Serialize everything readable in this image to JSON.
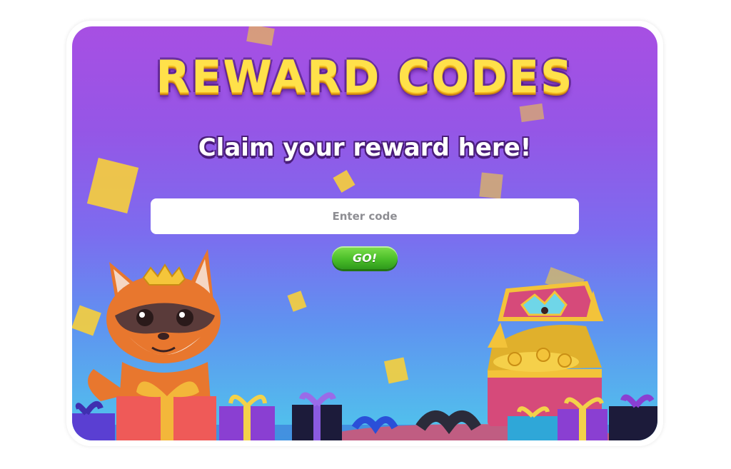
{
  "title": "REWARD CODES",
  "subtitle": "Claim your reward here!",
  "code_input": {
    "placeholder": "Enter code",
    "value": ""
  },
  "go_button": {
    "label": "GO!"
  },
  "illustration": {
    "mascot": "fox-mascot",
    "chest": "treasure-chest-icon",
    "gifts": "gift-box-icon"
  },
  "colors": {
    "bg_top": "#a74fe3",
    "bg_bottom": "#4fc6ec",
    "title": "#ffe14a",
    "button": "#4cbf2a",
    "confetti": "#f7cf3b"
  }
}
